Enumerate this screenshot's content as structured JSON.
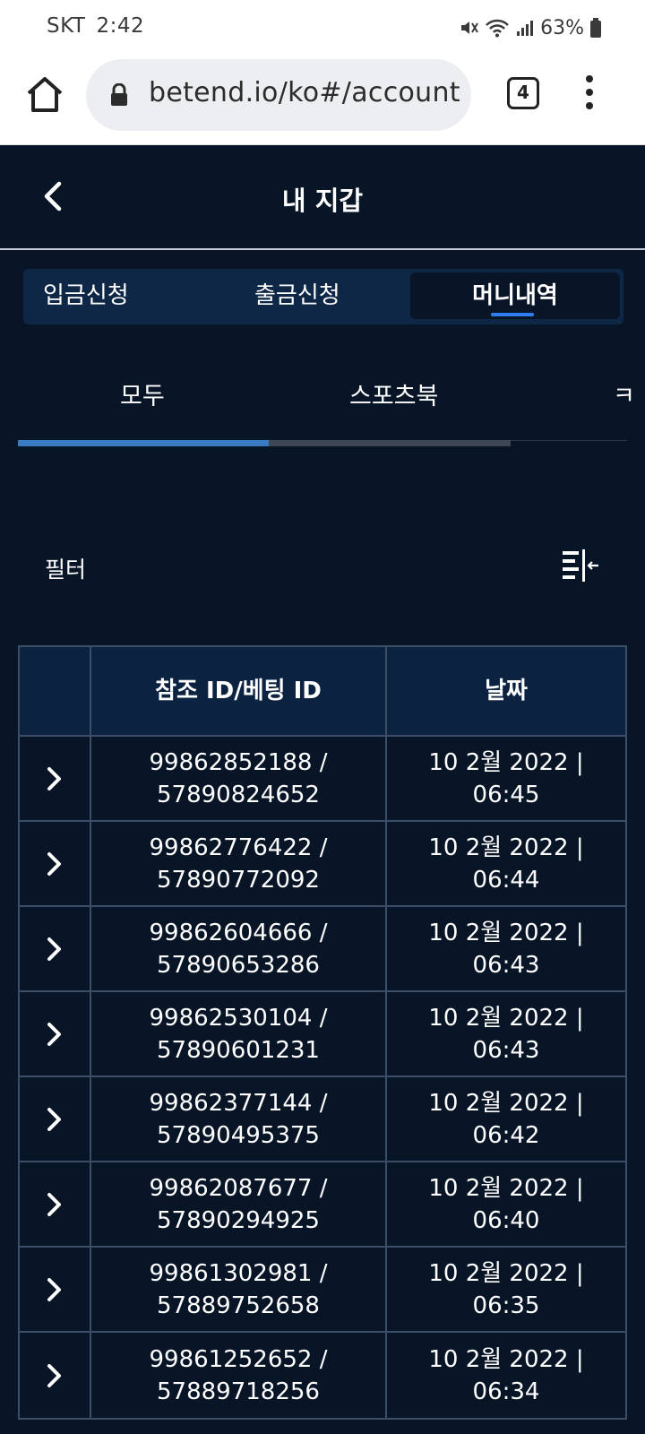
{
  "status_bar": {
    "carrier": "SKT",
    "time": "2:42",
    "battery": "63%"
  },
  "browser": {
    "url": "betend.io/ko#/account",
    "tab_count": "4"
  },
  "header": {
    "title": "내 지갑"
  },
  "segments": [
    {
      "label": "입금신청"
    },
    {
      "label": "출금신청"
    },
    {
      "label": "머니내역"
    }
  ],
  "filter_tabs": [
    {
      "label": "모두"
    },
    {
      "label": "스포츠북"
    },
    {
      "label": "ㅋ"
    }
  ],
  "filter": {
    "label": "필터"
  },
  "table": {
    "headers": {
      "ref": "참조 ID/베팅 ID",
      "date": "날짜"
    },
    "rows": [
      {
        "ref1": "99862852188 /",
        "ref2": "57890824652",
        "date1": "10 2월 2022 |",
        "date2": "06:45"
      },
      {
        "ref1": "99862776422 /",
        "ref2": "57890772092",
        "date1": "10 2월 2022 |",
        "date2": "06:44"
      },
      {
        "ref1": "99862604666 /",
        "ref2": "57890653286",
        "date1": "10 2월 2022 |",
        "date2": "06:43"
      },
      {
        "ref1": "99862530104 /",
        "ref2": "57890601231",
        "date1": "10 2월 2022 |",
        "date2": "06:43"
      },
      {
        "ref1": "99862377144 /",
        "ref2": "57890495375",
        "date1": "10 2월 2022 |",
        "date2": "06:42"
      },
      {
        "ref1": "99862087677 /",
        "ref2": "57890294925",
        "date1": "10 2월 2022 |",
        "date2": "06:40"
      },
      {
        "ref1": "99861302981 /",
        "ref2": "57889752658",
        "date1": "10 2월 2022 |",
        "date2": "06:35"
      },
      {
        "ref1": "99861252652 /",
        "ref2": "57889718256",
        "date1": "10 2월 2022 |",
        "date2": "06:34"
      }
    ]
  },
  "colors": {
    "background": "#081527",
    "accent": "#2d7ff0",
    "segment_bg": "#0f2746",
    "border": "#3b4e66"
  }
}
